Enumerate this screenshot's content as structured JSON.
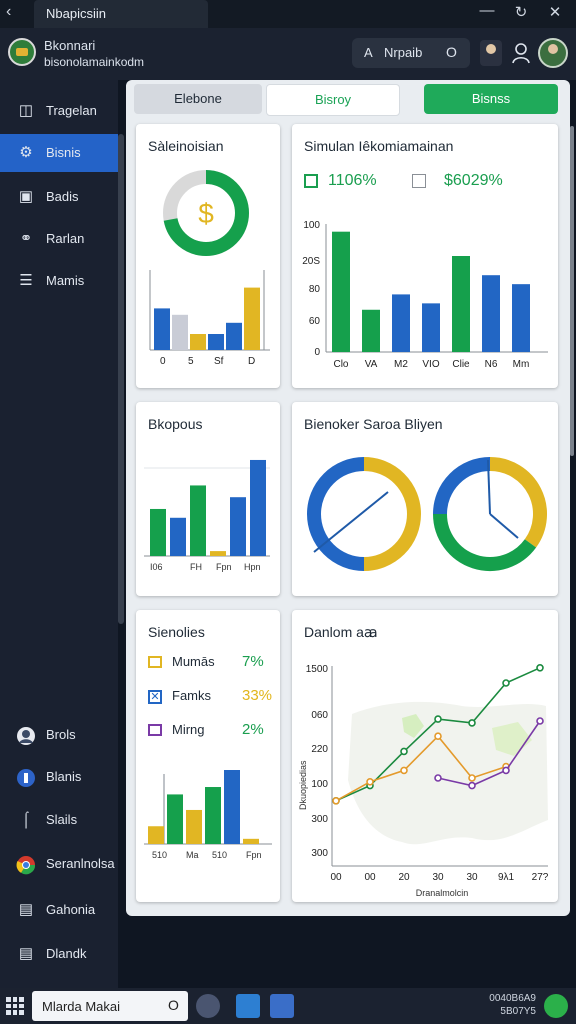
{
  "window": {
    "title": "Nbapicsiin",
    "controls": [
      "minimize",
      "maximize",
      "close"
    ]
  },
  "account": {
    "name": "Bkonnari",
    "subtitle": "bisonolamainkodm"
  },
  "search": {
    "prefix": "A",
    "value": "Nrpaib",
    "suffix": "O"
  },
  "sidebar": {
    "items": [
      {
        "label": "Tragelan",
        "icon": "layout-icon"
      },
      {
        "label": "Bisnis",
        "icon": "gear-icon",
        "active": true
      },
      {
        "label": "Badis",
        "icon": "card-icon"
      },
      {
        "label": "Rarlan",
        "icon": "link-icon"
      },
      {
        "label": "Mamis",
        "icon": "list-icon"
      }
    ],
    "bottom_items": [
      {
        "label": "Brols",
        "icon": "avatar-icon"
      },
      {
        "label": "Blanis",
        "icon": "circle-icon"
      },
      {
        "label": "Slails",
        "icon": "chart-icon"
      },
      {
        "label": "Seranlnolsa",
        "icon": "chrome-icon"
      },
      {
        "label": "Gahonia",
        "icon": "monitor-icon"
      },
      {
        "label": "Dlandk",
        "icon": "document-icon"
      }
    ]
  },
  "tabs": [
    {
      "label": "Elebone"
    },
    {
      "label": "Bisroy"
    },
    {
      "label": "Bisnss"
    }
  ],
  "cards": {
    "sales": {
      "title": "Sàleinoisian",
      "donut_symbol": "$"
    },
    "simulation": {
      "title": "Simulan Iêkomiamainan",
      "stat1": "1106%",
      "stat2": "$6029%"
    },
    "bkopous": {
      "title": "Bkopous"
    },
    "bienoker": {
      "title": "Bienoker Saroa Bliyen"
    },
    "sienolies": {
      "title": "Sienolies",
      "legend": [
        {
          "label": "Mumās",
          "value": "7%",
          "color": "#1a9e4f"
        },
        {
          "label": "Famks",
          "value": "33%",
          "color": "#e2b61c"
        },
        {
          "label": "Mirng",
          "value": "2%",
          "color": "#1a9e4f"
        }
      ]
    },
    "danlom": {
      "title": "Danlom aꜳ"
    }
  },
  "chart_data": [
    {
      "type": "donut",
      "title": "Sàleinoisian",
      "center_label": "$",
      "values": [
        72,
        28
      ],
      "colors": [
        "#15a04c",
        "#d9d9d9"
      ]
    },
    {
      "type": "bar",
      "title": "Sàleinoisian",
      "categories": [
        "0",
        "5",
        "Sf",
        "D"
      ],
      "series": [
        {
          "values": [
            52,
            44,
            20,
            20,
            34,
            78
          ]
        }
      ],
      "colors": [
        "#2266c4",
        "#c9ccd6",
        "#e1b623",
        "#2266c4",
        "#2266c4",
        "#e1b623"
      ],
      "tick_labels": [
        "0",
        "5",
        "Sf",
        "D"
      ]
    },
    {
      "type": "bar",
      "title": "Simulan Iêkomiamainan",
      "categories": [
        "Clo",
        "VA",
        "M2",
        "VIO",
        "Clie",
        "N6",
        "Mm"
      ],
      "values": [
        94,
        33,
        45,
        38,
        75,
        60,
        53
      ],
      "colors": [
        "#15a04c",
        "#15a04c",
        "#2266c4",
        "#2266c4",
        "#15a04c",
        "#2266c4",
        "#2266c4"
      ],
      "yticks": [
        "0",
        "60",
        "80",
        "20S",
        "100"
      ],
      "ylim": [
        0,
        100
      ]
    },
    {
      "type": "bar",
      "title": "Bkopous",
      "categories": [
        "I06",
        "FH",
        "Fpn",
        "Hpn"
      ],
      "values": [
        48,
        39,
        72,
        5,
        60,
        98
      ],
      "colors": [
        "#15a04c",
        "#2266c4",
        "#15a04c",
        "#e1b623",
        "#2266c4",
        "#2266c4"
      ],
      "tick_labels": [
        "I06",
        "FH",
        "Fpn",
        "Hpn"
      ]
    },
    {
      "type": "donut",
      "title": "Bienoker Saroa Bliyen",
      "values": [
        50,
        50
      ],
      "colors": [
        "#e1b623",
        "#2266c4"
      ]
    },
    {
      "type": "donut",
      "title": "Bienoker Saroa Bliyen",
      "values": [
        35,
        40,
        25
      ],
      "colors": [
        "#e1b623",
        "#15a04c",
        "#2266c4"
      ]
    },
    {
      "type": "bar",
      "title": "Sienolies",
      "categories": [
        "510",
        "Ma",
        "510",
        "Fpn"
      ],
      "values": [
        24,
        67,
        46,
        77,
        100,
        7
      ],
      "colors": [
        "#e1b623",
        "#15a04c",
        "#e1b623",
        "#15a04c",
        "#2266c4",
        "#e1b623"
      ],
      "tick_labels": [
        "510",
        "Ma",
        "510",
        "Fpn"
      ]
    },
    {
      "type": "line",
      "title": "Danlom aꜳ",
      "xlabel": "Dranalmolcin",
      "ylabel": "Dkuopiedias",
      "xticks": [
        "00",
        "00",
        "20",
        "30",
        "30",
        "9λ1",
        "27?"
      ],
      "yticks": [
        "1500",
        "060",
        "220",
        "100",
        "300",
        "300"
      ],
      "series": [
        {
          "name": "green",
          "color": "#1b8a3f",
          "x": [
            0,
            1,
            2,
            3,
            4,
            5,
            6
          ],
          "y": [
            28,
            36,
            54,
            71,
            69,
            90,
            98
          ]
        },
        {
          "name": "orange",
          "color": "#e49a2b",
          "x": [
            0,
            1,
            2,
            3,
            4,
            5
          ],
          "y": [
            28,
            38,
            44,
            62,
            40,
            46
          ]
        },
        {
          "name": "purple",
          "color": "#7a3aa6",
          "x": [
            3,
            4,
            5,
            6
          ],
          "y": [
            40,
            36,
            44,
            70
          ]
        }
      ]
    }
  ],
  "taskbar": {
    "search_text": "Mlarda Makai",
    "search_icon": "O",
    "clock_line1": "0040B6A9",
    "clock_line2": "5B07Y5"
  }
}
